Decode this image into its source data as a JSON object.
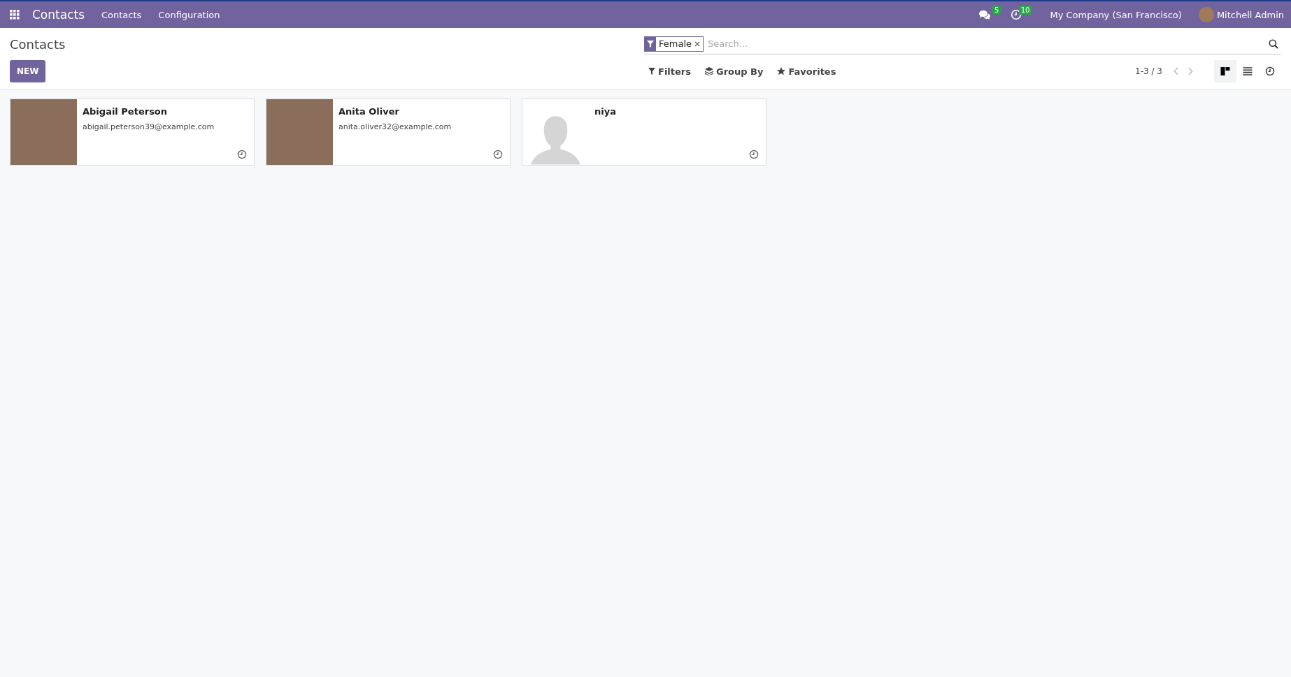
{
  "navbar": {
    "app_name": "Contacts",
    "menus": [
      "Contacts",
      "Configuration"
    ],
    "messages_count": "5",
    "activities_count": "10",
    "company": "My Company (San Francisco)",
    "user": "Mitchell Admin"
  },
  "control_panel": {
    "title": "Contacts",
    "new_button": "NEW",
    "facets": [
      {
        "label": "Female"
      }
    ],
    "search": {
      "placeholder": "Search..."
    },
    "filters": "Filters",
    "group_by": "Group By",
    "favorites": "Favorites",
    "pager": "1-3 / 3",
    "views": [
      {
        "kind": "kanban",
        "selected": true
      },
      {
        "kind": "list",
        "selected": false
      },
      {
        "kind": "activity",
        "selected": false
      }
    ]
  },
  "cards": [
    {
      "name": "Abigail Peterson",
      "email": "abigail.peterson39@example.com",
      "kind": "photo"
    },
    {
      "name": "Anita Oliver",
      "email": "anita.oliver32@example.com",
      "kind": "photo"
    },
    {
      "name": "niya",
      "kind": "placeholder"
    }
  ]
}
